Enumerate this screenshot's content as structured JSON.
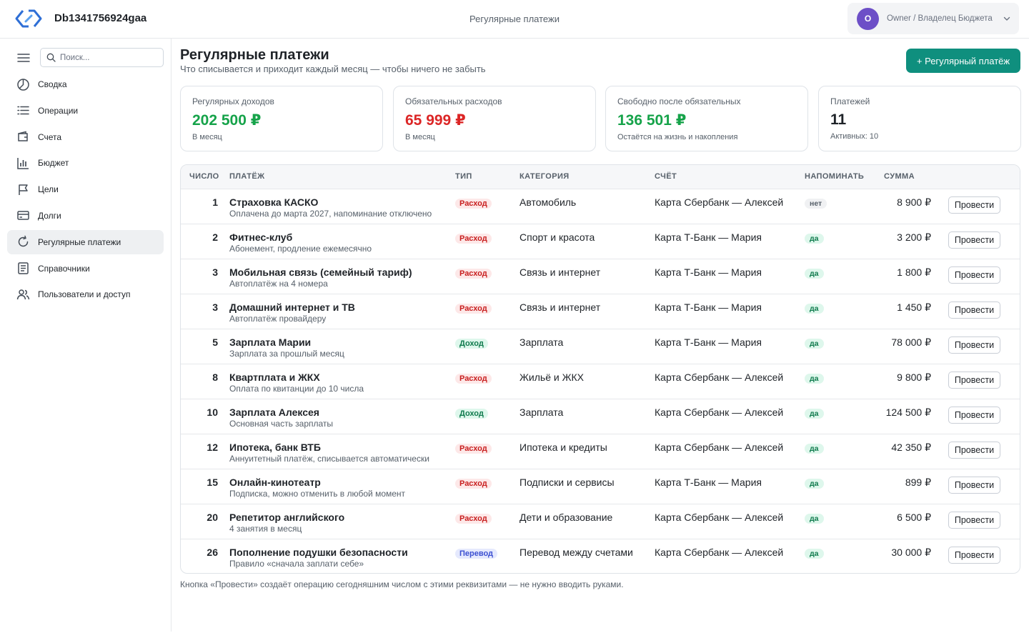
{
  "app": {
    "title": "Db1341756924gaa"
  },
  "topbar": {
    "center_title": "Регулярные платежи"
  },
  "user": {
    "initial": "O",
    "label": "Owner / Владелец Бюджета"
  },
  "search": {
    "placeholder": "Поиск..."
  },
  "sidebar": {
    "items": [
      {
        "label": "Сводка",
        "icon": "pie-chart-icon",
        "active": false
      },
      {
        "label": "Операции",
        "icon": "list-icon",
        "active": false
      },
      {
        "label": "Счета",
        "icon": "wallet-icon",
        "active": false
      },
      {
        "label": "Бюджет",
        "icon": "bar-chart-icon",
        "active": false
      },
      {
        "label": "Цели",
        "icon": "flag-icon",
        "active": false
      },
      {
        "label": "Долги",
        "icon": "credit-card-icon",
        "active": false
      },
      {
        "label": "Регулярные платежи",
        "icon": "refresh-icon",
        "active": true
      },
      {
        "label": "Справочники",
        "icon": "book-icon",
        "active": false
      },
      {
        "label": "Пользователи и доступ",
        "icon": "users-icon",
        "active": false
      }
    ]
  },
  "page": {
    "title": "Регулярные платежи",
    "subtitle": "Что списывается и приходит каждый месяц — чтобы ничего не забыть",
    "add_button": "+ Регулярный платёж"
  },
  "stats": [
    {
      "label": "Регулярных доходов",
      "value": "202 500 ₽",
      "note": "В месяц",
      "color": "#16a34a"
    },
    {
      "label": "Обязательных расходов",
      "value": "65 999 ₽",
      "note": "В месяц",
      "color": "#dc2626"
    },
    {
      "label": "Свободно после обязательных",
      "value": "136 501 ₽",
      "note": "Остаётся на жизнь и накопления",
      "color": "#16a34a"
    },
    {
      "label": "Платежей",
      "value": "11",
      "note": "Активных: 10",
      "color": "#1f2328"
    }
  ],
  "table": {
    "headers": {
      "day": "ЧИСЛО",
      "payment": "ПЛАТЁЖ",
      "type": "ТИП",
      "category": "КАТЕГОРИЯ",
      "account": "СЧЁТ",
      "remind": "НАПОМИНАТЬ",
      "amount": "СУММА"
    },
    "action_label": "Провести",
    "rows": [
      {
        "day": "1",
        "name": "Страховка КАСКО",
        "desc": "Оплачена до марта 2027, напоминание отключено",
        "type": "Расход",
        "type_kind": "expense",
        "category": "Автомобиль",
        "account": "Карта Сбербанк — Алексей",
        "remind": "нет",
        "remind_on": false,
        "amount": "8 900 ₽"
      },
      {
        "day": "2",
        "name": "Фитнес-клуб",
        "desc": "Абонемент, продление ежемесячно",
        "type": "Расход",
        "type_kind": "expense",
        "category": "Спорт и красота",
        "account": "Карта Т-Банк — Мария",
        "remind": "да",
        "remind_on": true,
        "amount": "3 200 ₽"
      },
      {
        "day": "3",
        "name": "Мобильная связь (семейный тариф)",
        "desc": "Автоплатёж на 4 номера",
        "type": "Расход",
        "type_kind": "expense",
        "category": "Связь и интернет",
        "account": "Карта Т-Банк — Мария",
        "remind": "да",
        "remind_on": true,
        "amount": "1 800 ₽"
      },
      {
        "day": "3",
        "name": "Домашний интернет и ТВ",
        "desc": "Автоплатёж провайдеру",
        "type": "Расход",
        "type_kind": "expense",
        "category": "Связь и интернет",
        "account": "Карта Т-Банк — Мария",
        "remind": "да",
        "remind_on": true,
        "amount": "1 450 ₽"
      },
      {
        "day": "5",
        "name": "Зарплата Марии",
        "desc": "Зарплата за прошлый месяц",
        "type": "Доход",
        "type_kind": "income",
        "category": "Зарплата",
        "account": "Карта Т-Банк — Мария",
        "remind": "да",
        "remind_on": true,
        "amount": "78 000 ₽"
      },
      {
        "day": "8",
        "name": "Квартплата и ЖКХ",
        "desc": "Оплата по квитанции до 10 числа",
        "type": "Расход",
        "type_kind": "expense",
        "category": "Жильё и ЖКХ",
        "account": "Карта Сбербанк — Алексей",
        "remind": "да",
        "remind_on": true,
        "amount": "9 800 ₽"
      },
      {
        "day": "10",
        "name": "Зарплата Алексея",
        "desc": "Основная часть зарплаты",
        "type": "Доход",
        "type_kind": "income",
        "category": "Зарплата",
        "account": "Карта Сбербанк — Алексей",
        "remind": "да",
        "remind_on": true,
        "amount": "124 500 ₽"
      },
      {
        "day": "12",
        "name": "Ипотека, банк ВТБ",
        "desc": "Аннуитетный платёж, списывается автоматически",
        "type": "Расход",
        "type_kind": "expense",
        "category": "Ипотека и кредиты",
        "account": "Карта Сбербанк — Алексей",
        "remind": "да",
        "remind_on": true,
        "amount": "42 350 ₽"
      },
      {
        "day": "15",
        "name": "Онлайн-кинотеатр",
        "desc": "Подписка, можно отменить в любой момент",
        "type": "Расход",
        "type_kind": "expense",
        "category": "Подписки и сервисы",
        "account": "Карта Т-Банк — Мария",
        "remind": "да",
        "remind_on": true,
        "amount": "899 ₽"
      },
      {
        "day": "20",
        "name": "Репетитор английского",
        "desc": "4 занятия в месяц",
        "type": "Расход",
        "type_kind": "expense",
        "category": "Дети и образование",
        "account": "Карта Сбербанк — Алексей",
        "remind": "да",
        "remind_on": true,
        "amount": "6 500 ₽"
      },
      {
        "day": "26",
        "name": "Пополнение подушки безопасности",
        "desc": "Правило «сначала заплати себе»",
        "type": "Перевод",
        "type_kind": "transfer",
        "category": "Перевод между счетами",
        "account": "Карта Сбербанк — Алексей",
        "remind": "да",
        "remind_on": true,
        "amount": "30 000 ₽"
      }
    ]
  },
  "footnote": "Кнопка «Провести» создаёт операцию сегодняшним числом с этими реквизитами — не нужно вводить руками."
}
